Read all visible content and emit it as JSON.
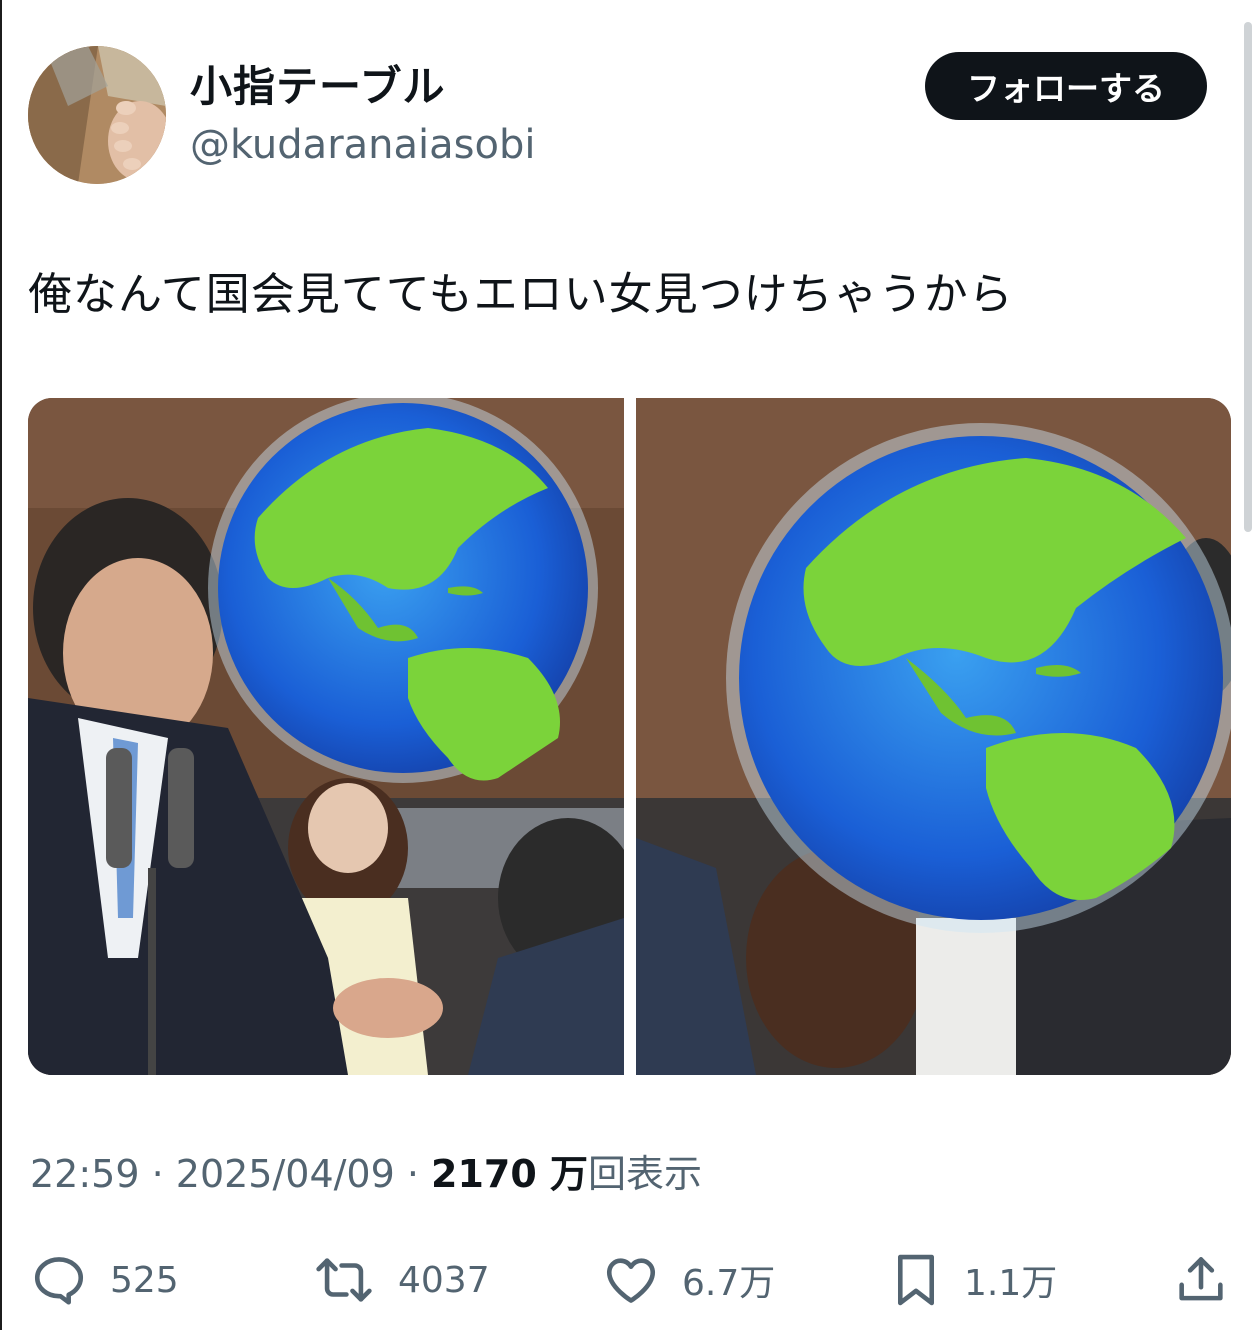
{
  "author": {
    "display_name": "小指テーブル",
    "handle": "@kudaranaiasobi",
    "follow_label": "フォローする"
  },
  "tweet": {
    "text": "俺なんて国会見ててもエロい女見つけちゃうから",
    "time": "22:59",
    "date": "2025/04/09",
    "separator": " · ",
    "views_count": "2170 万",
    "views_label": "回表示"
  },
  "actions": {
    "replies": "525",
    "retweets": "4037",
    "likes": "6.7万",
    "bookmarks": "1.1万"
  },
  "icons": {
    "reply": "speech-bubble-icon",
    "retweet": "retweet-arrows-icon",
    "like": "heart-icon",
    "bookmark": "bookmark-icon",
    "share": "share-upload-icon",
    "overlay": "globe-americas-emoji"
  },
  "colors": {
    "text": "#0f1419",
    "secondary": "#536471",
    "follow_bg": "#0f1419"
  }
}
